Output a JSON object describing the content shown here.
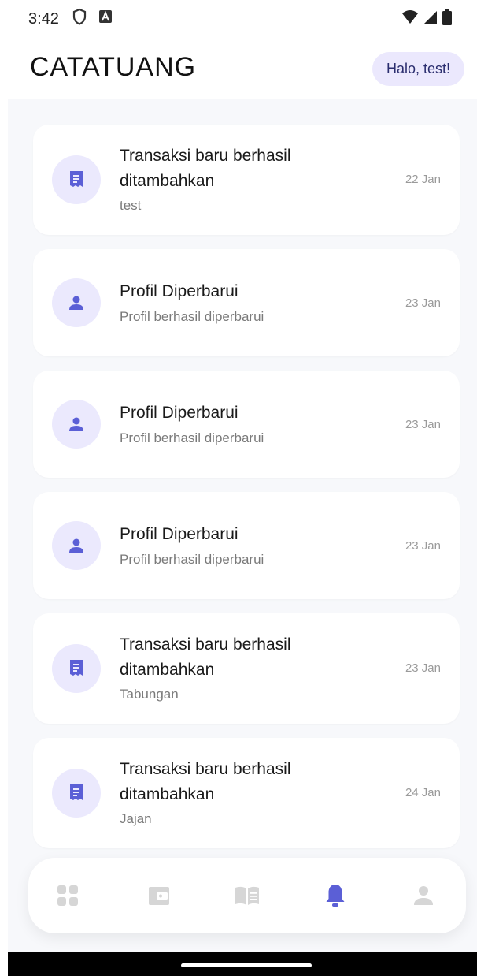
{
  "status_bar": {
    "time": "3:42",
    "icons": [
      "shield-icon",
      "a-badge-icon"
    ],
    "right_icons": [
      "wifi-icon",
      "cellular-icon",
      "battery-icon"
    ]
  },
  "header": {
    "title": "CATATUANG",
    "greeting": "Halo, test!"
  },
  "notifications": [
    {
      "icon": "receipt-icon",
      "title": "Transaksi baru berhasil ditambahkan",
      "subtitle": "test",
      "date": "22 Jan"
    },
    {
      "icon": "person-icon",
      "title": "Profil Diperbarui",
      "subtitle": "Profil berhasil diperbarui",
      "date": "23 Jan"
    },
    {
      "icon": "person-icon",
      "title": "Profil Diperbarui",
      "subtitle": "Profil berhasil diperbarui",
      "date": "23 Jan"
    },
    {
      "icon": "person-icon",
      "title": "Profil Diperbarui",
      "subtitle": "Profil berhasil diperbarui",
      "date": "23 Jan"
    },
    {
      "icon": "receipt-icon",
      "title": "Transaksi baru berhasil ditambahkan",
      "subtitle": "Tabungan",
      "date": "23 Jan"
    },
    {
      "icon": "receipt-icon",
      "title": "Transaksi baru berhasil ditambahkan",
      "subtitle": "Jajan",
      "date": "24 Jan"
    }
  ],
  "bottom_nav": {
    "items": [
      "dashboard-icon",
      "wallet-icon",
      "book-icon",
      "bell-icon",
      "profile-icon"
    ],
    "active": "bell-icon"
  },
  "colors": {
    "accent": "#5b5fd6",
    "icon_bg": "#ebe9fd",
    "inactive_icon": "#d6d6d6",
    "content_bg": "#f7f8fb"
  }
}
